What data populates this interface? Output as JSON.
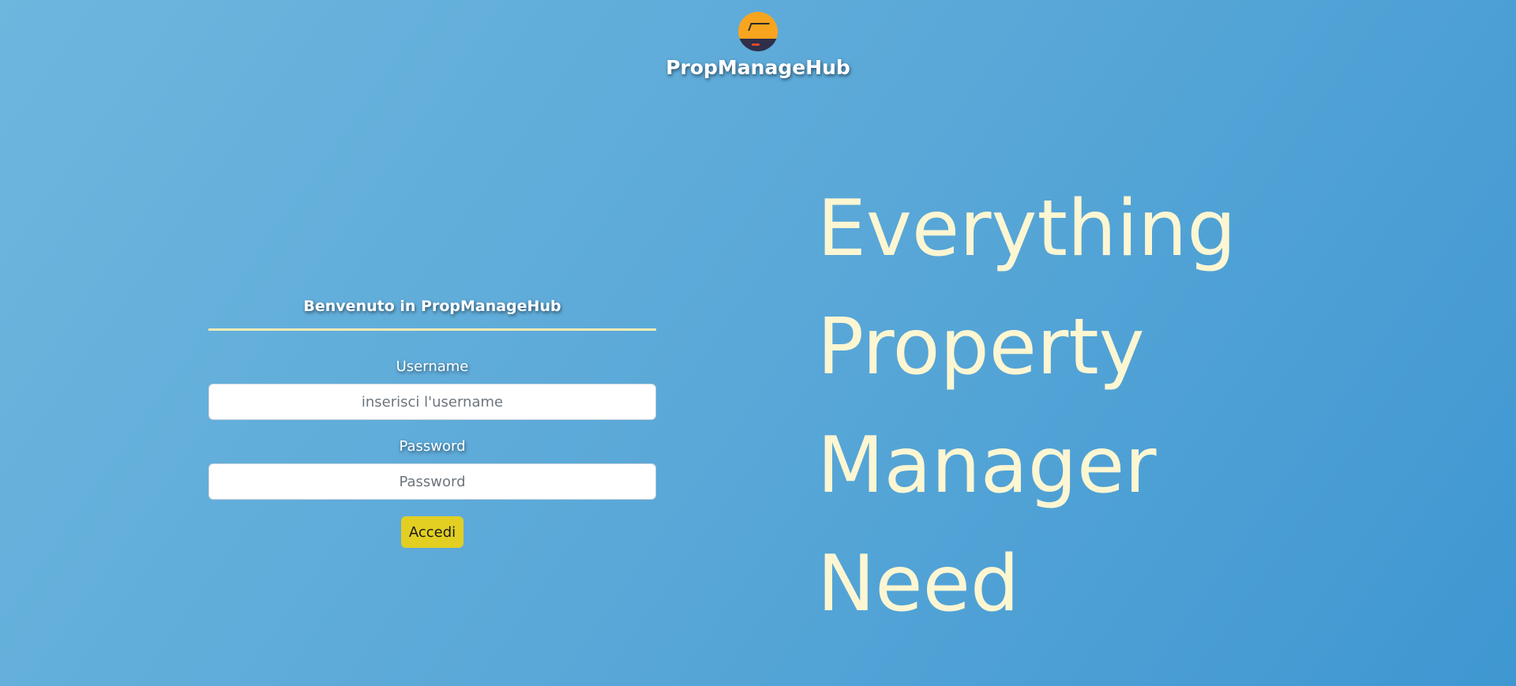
{
  "header": {
    "logo_icon": "house-roof-icon",
    "brand_name": "PropManageHub"
  },
  "login": {
    "welcome_text": "Benvenuto in PropManageHub",
    "username_label": "Username",
    "username_placeholder": "inserisci l'username",
    "username_value": "",
    "password_label": "Password",
    "password_placeholder": "Password",
    "password_value": "",
    "submit_label": "Accedi"
  },
  "tagline": {
    "lines": [
      "Everything",
      "Property",
      "Manager",
      "Need"
    ]
  },
  "colors": {
    "background_start": "#6db6de",
    "background_end": "#3f97d1",
    "button": "#e2cf22",
    "tagline_text": "#fdf6d2",
    "divider": "#f1ecb4",
    "logo_orange": "#f7a51f"
  }
}
